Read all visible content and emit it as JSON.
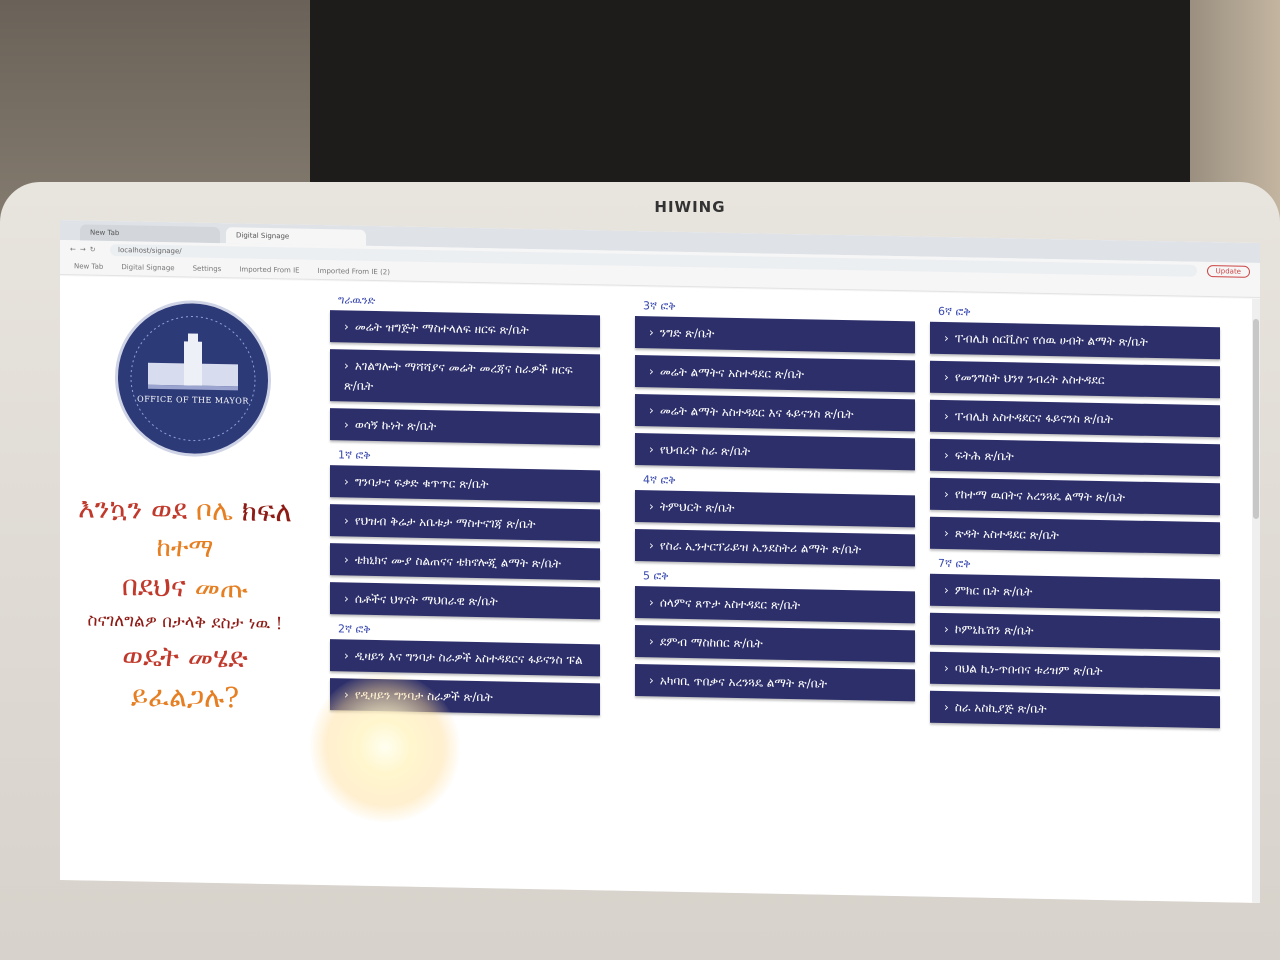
{
  "monitor": {
    "brand": "HIWING"
  },
  "browser": {
    "tabs": [
      {
        "title": "New Tab"
      },
      {
        "title": "Digital Signage"
      }
    ],
    "url": "localhost/signage/",
    "bookmarks": [
      "New Tab",
      "Digital Signage",
      "Settings",
      "Imported From IE",
      "Imported From IE (2)"
    ],
    "update_label": "Update"
  },
  "logo": {
    "caption": "OFFICE OF THE MAYOR"
  },
  "welcome": {
    "line1_a": "እንኳን ወደ ",
    "line1_b": "ቦሌ ",
    "line1_c": "ክፍለ",
    "line2": "ከተማ",
    "line3_a": "በደህና ",
    "line3_b": "መጡ",
    "line4": "ስናገለግልዎ በታላቅ ደስታ ነዉ !",
    "line5": "ወዴት መሄድ",
    "line6": "ይፈልጋሉ?"
  },
  "columns": [
    {
      "sections": [
        {
          "title": "ግራዉንድ",
          "items": [
            "መሬት ዝግጅት ማስተላለፍ ዘርፍ ጽ/ቤት",
            "አገልግሎት ማሻሻያና መሬት መረጃና ስራዎች ዘርፍ ጽ/ቤት",
            "ወሳኝ ኩነት ጽ/ቤት"
          ]
        },
        {
          "title": "1ኛ ፎቅ",
          "items": [
            "ግንባታና ፍቃድ ቁጥጥር ጽ/ቤት",
            "የህዝብ ቅሬታ አቤቱታ ማስተናገጃ ጽ/ቤት",
            "ቴክኒክና ሙያ ስልጠናና ቴክኖሎጂ ልማት ጽ/ቤት",
            "ሴቶችና ህፃናት ማህበራዊ ጽ/ቤት"
          ]
        },
        {
          "title": "2ኛ ፎቅ",
          "items": [
            "ዲዛይን እና ግንባታ ስራዎች አስተዳደርና ፋይናንስ ፑል",
            "የዲዛይን ግንባታ ስራዎች ጽ/ቤት"
          ]
        }
      ]
    },
    {
      "sections": [
        {
          "title": "3ኛ ፎቅ",
          "items": [
            "ንግድ ጽ/ቤት",
            "መሬት ልማትና አስተዳደር ጽ/ቤት",
            "መሬት ልማት አስተዳደር እና ፋይናንስ ጽ/ቤት",
            "የህብረት ስራ ጽ/ቤት"
          ]
        },
        {
          "title": "4ኛ ፎቅ",
          "items": [
            "ትምህርት ጽ/ቤት",
            "የስራ ኢንተርፕራይዝ ኢንደስትሪ ልማት ጽ/ቤት"
          ]
        },
        {
          "title": "5 ፎቅ",
          "items": [
            "ሰላምና ጸጥታ አስተዳደር ጽ/ቤት",
            "ደምብ ማስከበር ጽ/ቤት",
            "አካባቢ ጥበቃና አረንጓዴ ልማት ጽ/ቤት"
          ]
        }
      ]
    },
    {
      "sections": [
        {
          "title": "6ኛ ፎቅ",
          "items": [
            "ፐብሊክ ሰርቪስና የሰዉ ሀብት ልማት ጽ/ቤት",
            "የመንግስት ህንፃ ንብረት አስተዳደር",
            "ፐብሊክ አስተዳደርና ፋይናንስ ጽ/ቤት",
            "ፍትሕ ጽ/ቤት",
            "የከተማ ዉበትና አረንጓዴ ልማት ጽ/ቤት",
            "ጽዳት አስተዳደር ጽ/ቤት"
          ]
        },
        {
          "title": "7ኛ ፎቅ",
          "items": [
            "ምክር ቤት ጽ/ቤት",
            "ኮምኒኬሽን ጽ/ቤት",
            "ባህል ኪነ-ጥበብና ቱሪዝም ጽ/ቤት",
            "ስራ አስኪያጅ ጽ/ቤት"
          ]
        }
      ]
    }
  ],
  "colors": {
    "button_bg": "#2d2f6b",
    "section_title": "#3a4ab0",
    "welcome_red": "#c0392b",
    "welcome_orange": "#e67e22"
  }
}
